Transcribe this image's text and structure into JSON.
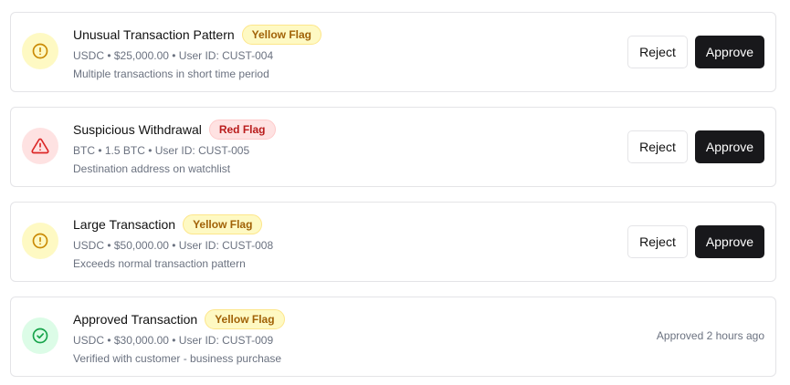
{
  "colors": {
    "yellow_icon": "#ca8a04",
    "red_icon": "#dc2626",
    "green_icon": "#16a34a",
    "approve_bg": "#18181b"
  },
  "items": [
    {
      "title": "Unusual Transaction Pattern",
      "flag": "Yellow Flag",
      "meta": "USDC • $25,000.00 • User ID: CUST-004",
      "description": "Multiple transactions in short time period",
      "icon": "alert-circle-icon",
      "reject_label": "Reject",
      "approve_label": "Approve"
    },
    {
      "title": "Suspicious Withdrawal",
      "flag": "Red Flag",
      "meta": "BTC • 1.5 BTC • User ID: CUST-005",
      "description": "Destination address on watchlist",
      "icon": "alert-triangle-icon",
      "reject_label": "Reject",
      "approve_label": "Approve"
    },
    {
      "title": "Large Transaction",
      "flag": "Yellow Flag",
      "meta": "USDC • $50,000.00 • User ID: CUST-008",
      "description": "Exceeds normal transaction pattern",
      "icon": "alert-circle-icon",
      "reject_label": "Reject",
      "approve_label": "Approve"
    },
    {
      "title": "Approved Transaction",
      "flag": "Yellow Flag",
      "meta": "USDC • $30,000.00 • User ID: CUST-009",
      "description": "Verified with customer - business purchase",
      "icon": "check-circle-icon",
      "status": "Approved 2 hours ago"
    }
  ]
}
